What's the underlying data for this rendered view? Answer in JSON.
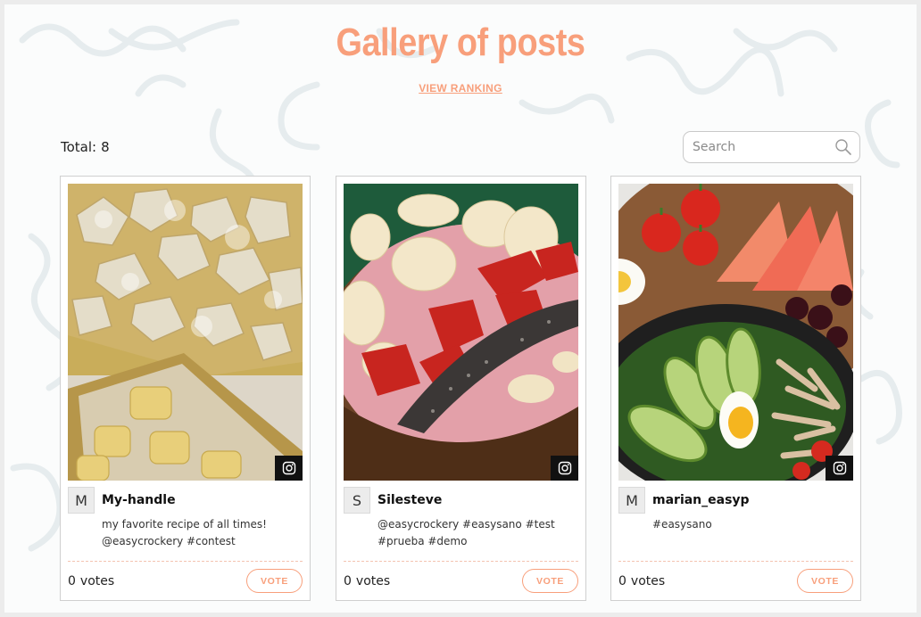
{
  "header": {
    "title": "Gallery of posts",
    "ranking_link": "VIEW RANKING"
  },
  "toolbar": {
    "total_label": "Total:",
    "total_count": "8",
    "search_placeholder": "Search"
  },
  "colors": {
    "accent": "#f89f7b",
    "divider": "#f3c3b1"
  },
  "posts": [
    {
      "avatar_letter": "M",
      "handle": "My-handle",
      "caption": "my favorite recipe of all times! @easycrockery #contest",
      "vote_count": "0",
      "votes_label": "votes",
      "vote_button": "VOTE",
      "source_icon": "instagram-icon",
      "image_subject": "ravioli-photo"
    },
    {
      "avatar_letter": "S",
      "handle": "Silesteve",
      "caption": "@easycrockery #easysano #test #prueba #demo",
      "vote_count": "0",
      "votes_label": "votes",
      "vote_button": "VOTE",
      "source_icon": "instagram-icon",
      "image_subject": "smoothie-bowl-photo"
    },
    {
      "avatar_letter": "M",
      "handle": "marian_easyp",
      "caption": "#easysano",
      "vote_count": "0",
      "votes_label": "votes",
      "vote_button": "VOTE",
      "source_icon": "instagram-icon",
      "image_subject": "salad-bowl-photo"
    }
  ]
}
